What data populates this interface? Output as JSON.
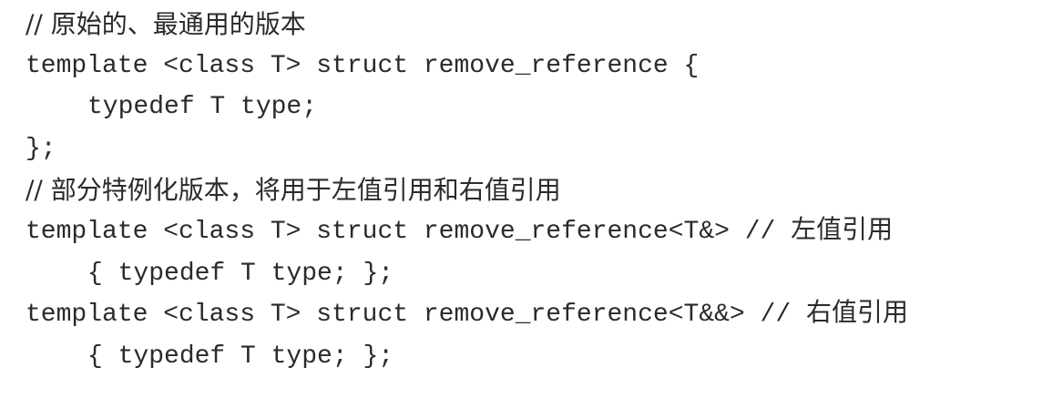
{
  "code": {
    "lines": [
      {
        "text": "// 原始的、最通用的版本"
      },
      {
        "text": "template <class T> struct remove_reference {"
      },
      {
        "text": "typedef T type;"
      },
      {
        "text": "};"
      },
      {
        "text": "// 部分特例化版本，将用于左值引用和右值引用"
      },
      {
        "text": "template <class T> struct remove_reference<T&> // 左值引用"
      },
      {
        "text": "{ typedef T type; };"
      },
      {
        "text": "template <class T> struct remove_reference<T&&> // 右值引用"
      },
      {
        "text": "{ typedef T type; };"
      }
    ]
  }
}
